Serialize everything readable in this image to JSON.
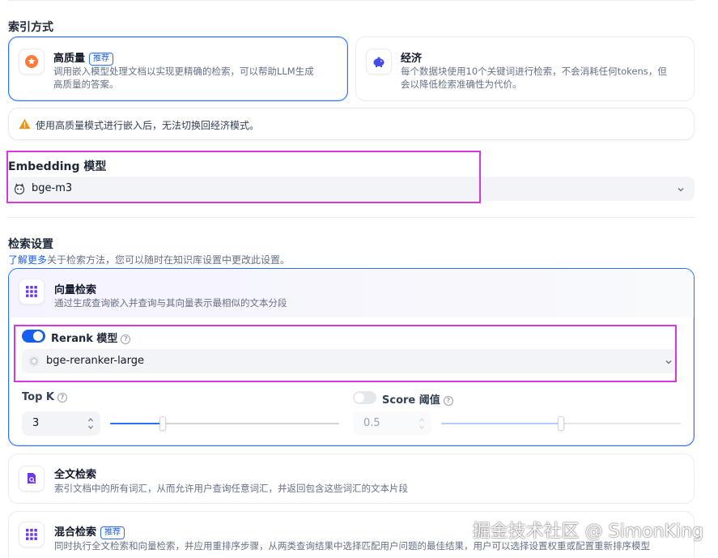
{
  "index_method": {
    "label": "索引方式",
    "high_quality": {
      "title": "高质量",
      "badge": "推荐",
      "desc_line1": "调用嵌入模型处理文档以实现更精确的检索，可以帮助LLM生成",
      "desc_line2": "高质量的答案。",
      "icon": "star-badge-icon",
      "icon_color": "#ff7a36"
    },
    "economy": {
      "title": "经济",
      "desc_line1": "每个数据块使用10个关键词进行检索，不会消耗任何tokens，但",
      "desc_line2": "会以降低检索准确性为代价。",
      "icon": "piggy-bank-icon",
      "icon_color": "#444ce7"
    },
    "warning": "使用高质量模式进行嵌入后，无法切换回经济模式。"
  },
  "embedding": {
    "label": "Embedding 模型",
    "model": "bge-m3",
    "icon": "model-logo-icon"
  },
  "retrieval": {
    "label": "检索设置",
    "learn_more": "了解更多",
    "hint": "关于检索方法，您可以随时在知识库设置中更改此设置。",
    "vector": {
      "title": "向量检索",
      "desc": "通过生成查询嵌入并查询与其向量表示最相似的文本分段",
      "icon": "grid-icon"
    },
    "rerank": {
      "label": "Rerank 模型",
      "enabled": true,
      "model": "bge-reranker-large"
    },
    "top_k": {
      "label": "Top K",
      "value": "3",
      "slider_fraction": 0.23
    },
    "score": {
      "label": "Score 阈值",
      "enabled": false,
      "value": "0.5",
      "slider_fraction": 0.5
    },
    "fulltext": {
      "title": "全文检索",
      "desc": "索引文档中的所有词汇，从而允许用户查询任意词汇，并返回包含这些词汇的文本片段",
      "icon": "document-search-icon"
    },
    "hybrid": {
      "title": "混合检索",
      "badge": "推荐",
      "desc": "同时执行全文检索和向量检索，并应用重排序步骤，从两类查询结果中选择匹配用户问题的最佳结果，用户可以选择设置权重或配置重新排序模型",
      "icon": "grid-icon"
    }
  },
  "watermark": "掘金技术社区 @ SimonKing",
  "colors": {
    "accent": "#2970ff",
    "highlight": "#d636e4",
    "warning": "#f79009",
    "purple_icon": "#6938ef"
  }
}
